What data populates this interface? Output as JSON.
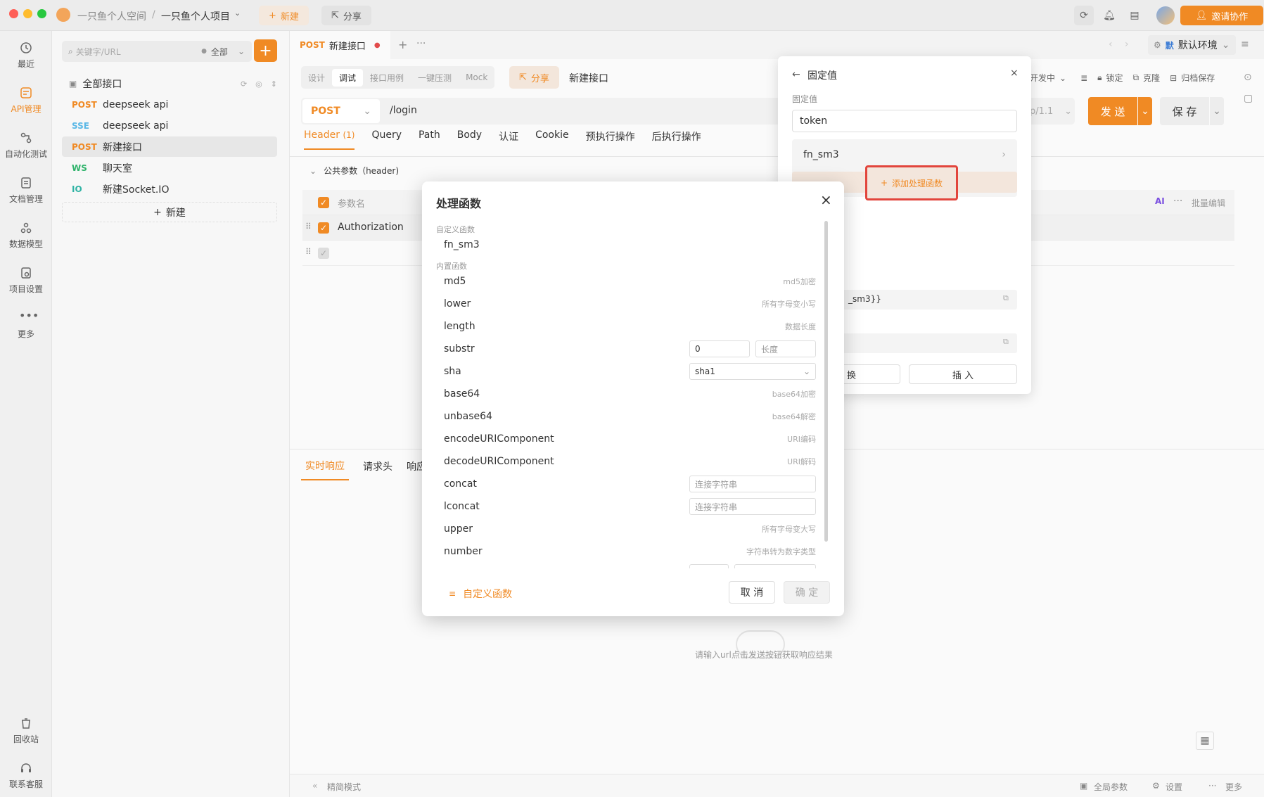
{
  "titlebar": {
    "space_name": "一只鱼个人空间",
    "separator": "/",
    "project_name": "一只鱼个人项目",
    "new_label": "新建",
    "share_label": "分享",
    "invite_label": "邀请协作"
  },
  "leftnav": {
    "items": [
      {
        "label": "最近",
        "icon": "clock-icon"
      },
      {
        "label": "API管理",
        "icon": "api-icon"
      },
      {
        "label": "自动化测试",
        "icon": "flow-icon"
      },
      {
        "label": "文档管理",
        "icon": "doc-icon"
      },
      {
        "label": "数据模型",
        "icon": "model-icon"
      },
      {
        "label": "项目设置",
        "icon": "settings-icon"
      },
      {
        "label": "更多",
        "icon": "more-icon"
      }
    ],
    "bottom": [
      {
        "label": "回收站",
        "icon": "trash-icon"
      },
      {
        "label": "联系客服",
        "icon": "headset-icon"
      }
    ]
  },
  "sidebar": {
    "search_placeholder": "关键字/URL",
    "filter_label": "全部",
    "tree_root": "全部接口",
    "items": [
      {
        "method": "POST",
        "name": "deepseek api",
        "color": "#f08a24"
      },
      {
        "method": "SSE",
        "name": "deepseek api",
        "color": "#5bb8e6"
      },
      {
        "method": "POST",
        "name": "新建接口",
        "color": "#f08a24"
      },
      {
        "method": "WS",
        "name": "聊天室",
        "color": "#2fb36b"
      },
      {
        "method": "IO",
        "name": "新建Socket.IO",
        "color": "#2fb3a4"
      }
    ],
    "new_label": "新建"
  },
  "main": {
    "tab": {
      "method": "POST",
      "name": "新建接口"
    },
    "env_label": "默认环境",
    "env_badge": "默",
    "subtabs": [
      "设计",
      "调试",
      "接口用例",
      "一键压测",
      "Mock"
    ],
    "share_label": "分享",
    "api_name": "新建接口",
    "status_label": "开发中",
    "lock_label": "锁定",
    "clone_label": "克隆",
    "archive_label": "归档保存",
    "method": "POST",
    "url": "/login",
    "protocol": "p/1.1",
    "send_label": "发 送",
    "save_label": "保 存",
    "req_tabs": [
      "Header",
      "Query",
      "Path",
      "Body",
      "认证",
      "Cookie",
      "预执行操作",
      "后执行操作"
    ],
    "header_count": "(1)",
    "public_params": "公共参数（header)",
    "param_col": "参数名",
    "param_row": "Authorization",
    "bulk_edit": "批量编辑",
    "ai_label": "AI",
    "resp_tabs": [
      "实时响应",
      "请求头",
      "响应"
    ],
    "empty_hint": "请输入url点击发送按钮获取响应结果",
    "footer": {
      "simple_mode": "精简模式",
      "global_params": "全局参数",
      "settings": "设置",
      "more": "更多"
    }
  },
  "fixed_popover": {
    "title": "固定值",
    "label": "固定值",
    "value": "token",
    "fn_item": "fn_sm3",
    "add_fn_label": "添加处理函数",
    "expression": "_sm3}}",
    "replace_label": "换",
    "insert_label": "插 入"
  },
  "modal": {
    "title": "处理函数",
    "custom_section": "自定义函数",
    "custom_items": [
      "fn_sm3"
    ],
    "builtin_section": "内置函数",
    "builtin": [
      {
        "name": "md5",
        "desc": "md5加密"
      },
      {
        "name": "lower",
        "desc": "所有字母变小写"
      },
      {
        "name": "length",
        "desc": "数据长度"
      },
      {
        "name": "substr",
        "input1": "0",
        "input2": "长度"
      },
      {
        "name": "sha",
        "select": "sha1"
      },
      {
        "name": "base64",
        "desc": "base64加密"
      },
      {
        "name": "unbase64",
        "desc": "base64解密"
      },
      {
        "name": "encodeURIComponent",
        "desc": "URI编码"
      },
      {
        "name": "decodeURIComponent",
        "desc": "URI解码"
      },
      {
        "name": "concat",
        "placeholder": "连接字符串"
      },
      {
        "name": "lconcat",
        "placeholder": "连接字符串"
      },
      {
        "name": "upper",
        "desc": "所有字母变大写"
      },
      {
        "name": "number",
        "desc": "字符串转为数字类型"
      }
    ],
    "custom_fn_link": "自定义函数",
    "cancel_label": "取 消",
    "confirm_label": "确 定"
  }
}
